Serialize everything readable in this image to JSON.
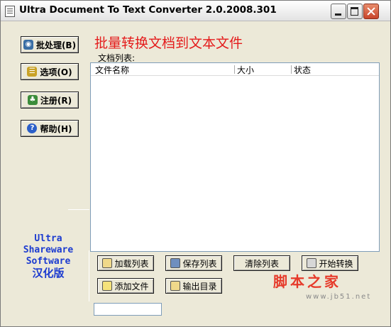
{
  "window": {
    "title": "Ultra Document To Text Converter 2.0.2008.301"
  },
  "sidebar": {
    "buttons": [
      {
        "label": "批处理(B)",
        "icon": "batch-icon"
      },
      {
        "label": "选项(O)",
        "icon": "options-icon"
      },
      {
        "label": "注册(R)",
        "icon": "register-icon"
      },
      {
        "label": "帮助(H)",
        "icon": "help-icon"
      }
    ],
    "brand": {
      "line1": "Ultra",
      "line2": "Shareware",
      "line3": "Software",
      "line4": "汉化版"
    }
  },
  "main": {
    "title": "批量转换文档到文本文件",
    "list_label": "文档列表:",
    "columns": [
      "文件名称",
      "大小",
      "状态"
    ]
  },
  "actions": {
    "load_list": "加载列表",
    "save_list": "保存列表",
    "clear_list": "清除列表",
    "start_convert": "开始转换",
    "add_file": "添加文件",
    "output_dir": "输出目录"
  },
  "watermark": {
    "text": "脚本之家",
    "sub": "www.jb51.net"
  },
  "colors": {
    "title_red": "#e41b1b",
    "brand_blue": "#1c3bd0",
    "window_bg": "#ece9d8"
  }
}
